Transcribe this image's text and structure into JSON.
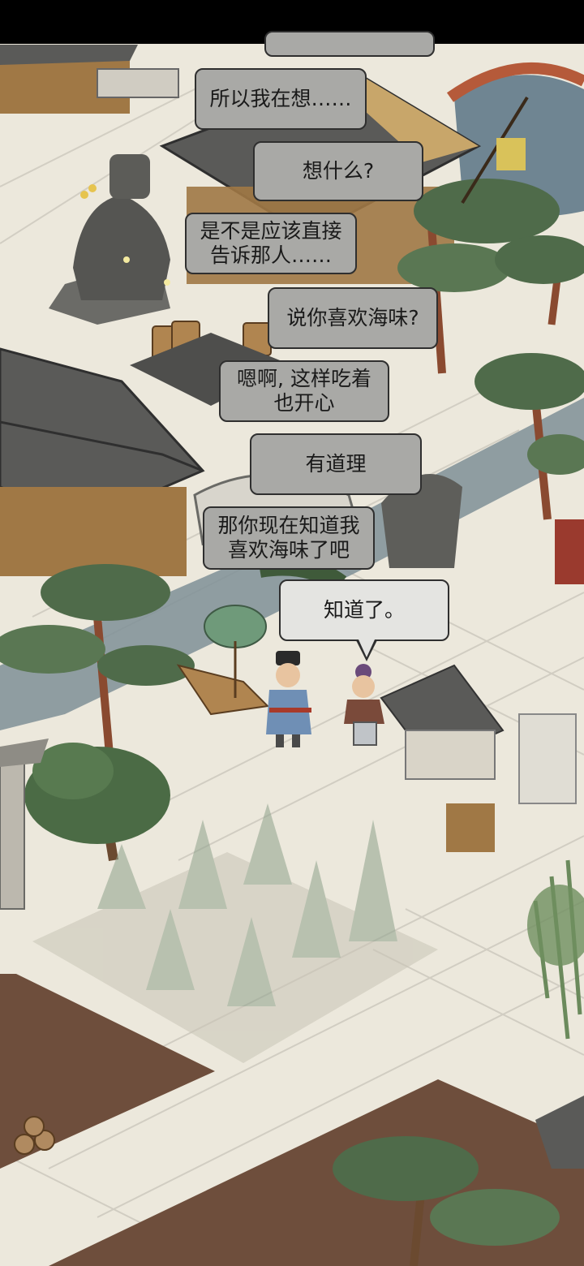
{
  "dialogue": [
    {
      "text": "所以我在想……",
      "style": "grey"
    },
    {
      "text": "想什么?",
      "style": "grey"
    },
    {
      "text": "是不是应该直接\n告诉那人……",
      "style": "grey"
    },
    {
      "text": "说你喜欢海味?",
      "style": "grey"
    },
    {
      "text": "嗯啊, 这样吃着\n也开心",
      "style": "grey"
    },
    {
      "text": "有道理",
      "style": "grey"
    },
    {
      "text": "那你现在知道我\n喜欢海味了吧",
      "style": "grey"
    },
    {
      "text": "知道了。",
      "style": "light"
    }
  ],
  "colors": {
    "paper": "#ece8dc",
    "roof": "#5a5a58",
    "wood": "#a07845",
    "water": "#7f8f96",
    "pine": "#4f6b4a",
    "soil": "#6e4e3c",
    "bubble_grey": "#a9a9a6",
    "bubble_light": "#e4e4e1"
  }
}
